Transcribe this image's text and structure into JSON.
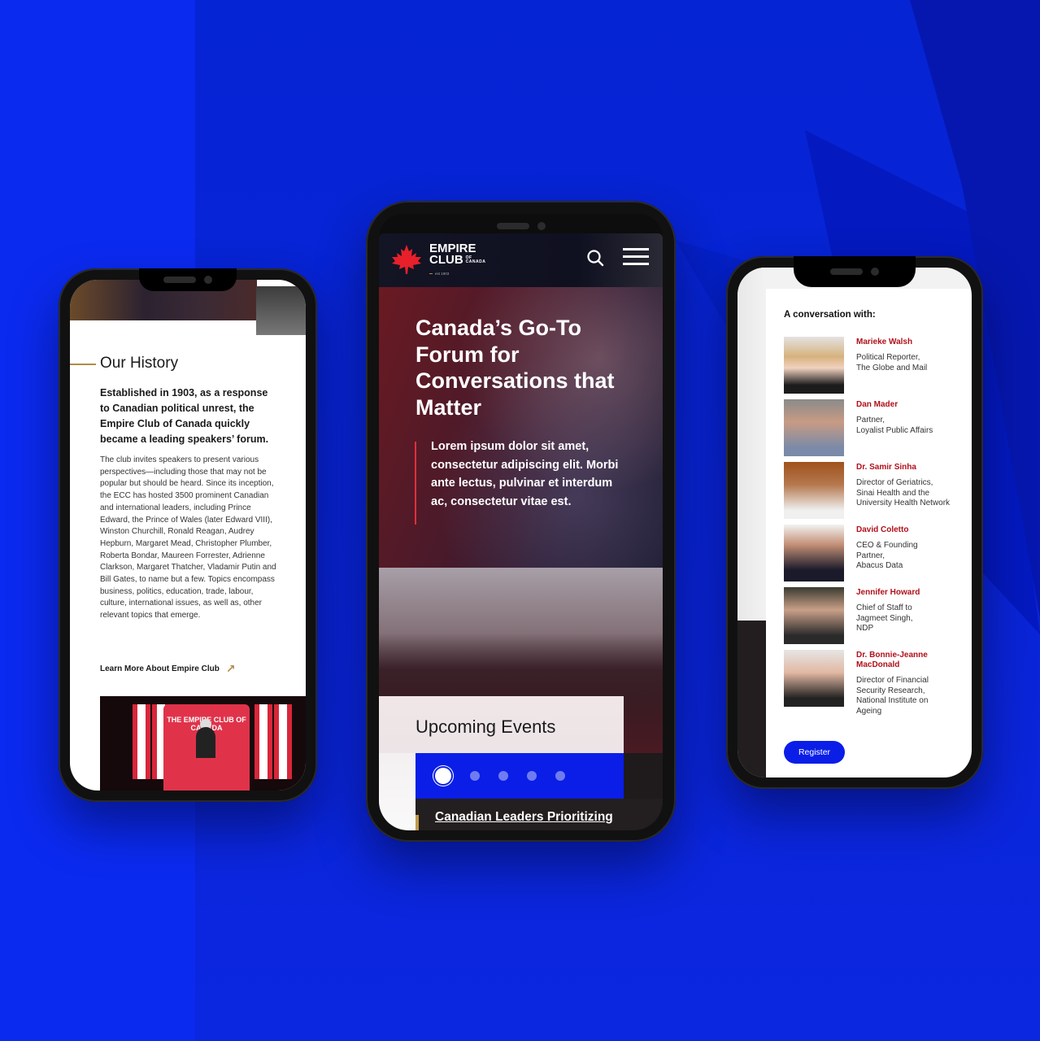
{
  "colors": {
    "background_blue": "#0a24e0",
    "brand_red": "#b0101a",
    "accent_red": "#e0303a",
    "gold": "#b08d4a",
    "cta_blue": "#0a1ee8"
  },
  "left_phone": {
    "section_title": "Our History",
    "lead": "Established in 1903, as a response to Canadian political unrest, the Empire Club of Canada quickly became a leading speakers’ forum.",
    "body": "The club invites speakers to present various perspectives—including those that may not be popular but should be heard. Since its inception, the ECC has hosted 3500 prominent Canadian and international leaders, including Prince Edward, the Prince of Wales (later Edward VIII), Winston Churchill, Ronald Reagan, Audrey Hepburn, Margaret Mead, Christopher Plumber, Roberta Bondar, Maureen Forrester, Adrienne Clarkson, Margaret Thatcher, Vladamir Putin and Bill Gates, to name but a few. Topics encompass business, politics, education, trade, labour, culture, international issues, as well as, other relevant topics that emerge.",
    "learn_more_link": "Learn More About Empire Club",
    "learn_more_icon": "arrow-up-right-icon",
    "event_photo_backdrop": "THE EMPIRE CLUB OF CANADA"
  },
  "center_phone": {
    "logo": {
      "line1": "EMPIRE",
      "line2": "CLUB",
      "sub": "OF CANADA",
      "est": "est 1903",
      "icon": "maple-leaf-icon"
    },
    "search_icon": "search-icon",
    "menu_icon": "hamburger-menu-icon",
    "hero_title": "Canada’s Go-To Forum for Conversations that Matter",
    "hero_quote": "Lorem ipsum dolor sit amet, consectetur adipiscing elit. Morbi ante lectus, pulvinar et interdum ac, consectetur vitae est.",
    "events_title": "Upcoming Events",
    "carousel": {
      "total_slides": 5,
      "active_slide": 1
    },
    "event_title": "Canadian Leaders Prioritizing"
  },
  "right_phone": {
    "heading": "A conversation with:",
    "speakers": [
      {
        "name": "Marieke Walsh",
        "role": "Political Reporter,\nThe Globe and Mail"
      },
      {
        "name": "Dan Mader",
        "role": "Partner,\nLoyalist Public Affairs"
      },
      {
        "name": "Dr. Samir Sinha",
        "role": "Director of Geriatrics,\nSinai Health and the\nUniversity Health Network"
      },
      {
        "name": "David Coletto",
        "role": "CEO & Founding\nPartner,\nAbacus Data"
      },
      {
        "name": "Jennifer Howard",
        "role": "Chief of Staff to\nJagmeet Singh,\nNDP"
      },
      {
        "name": "Dr. Bonnie-Jeanne MacDonald",
        "role": "Director of Financial\nSecurity Research,\nNational Institute on\nAgeing"
      }
    ],
    "register_button": "Register"
  }
}
